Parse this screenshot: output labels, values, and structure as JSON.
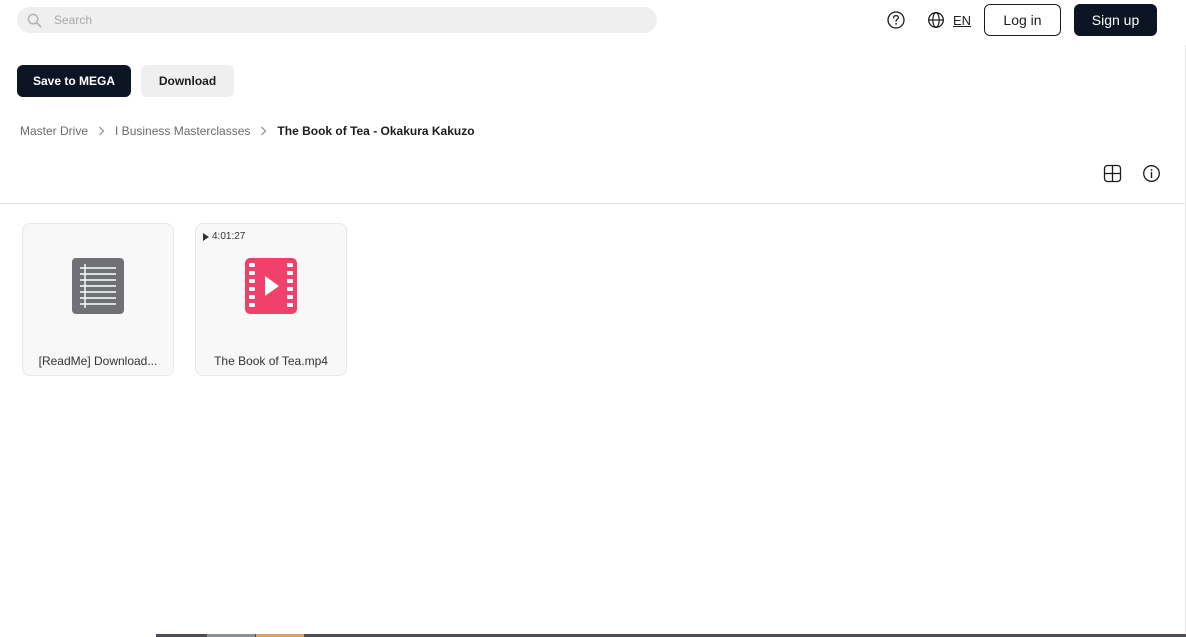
{
  "search": {
    "placeholder": "Search",
    "value": ""
  },
  "header": {
    "language": "EN",
    "login_label": "Log in",
    "signup_label": "Sign up"
  },
  "actions": {
    "save_label": "Save to MEGA",
    "download_label": "Download"
  },
  "breadcrumb": {
    "items": [
      "Master Drive",
      "I Business Masterclasses",
      "The Book of Tea - Okakura Kakuzo"
    ]
  },
  "files": [
    {
      "name": "[ReadMe] Download...",
      "type": "text-file-icon"
    },
    {
      "name": "The Book of Tea.mp4",
      "type": "video-file-icon",
      "duration": "4:01:27"
    }
  ],
  "colors": {
    "primary_dark": "#0b1523",
    "video_icon": "#f0416b",
    "text_icon": "#6f7175"
  }
}
